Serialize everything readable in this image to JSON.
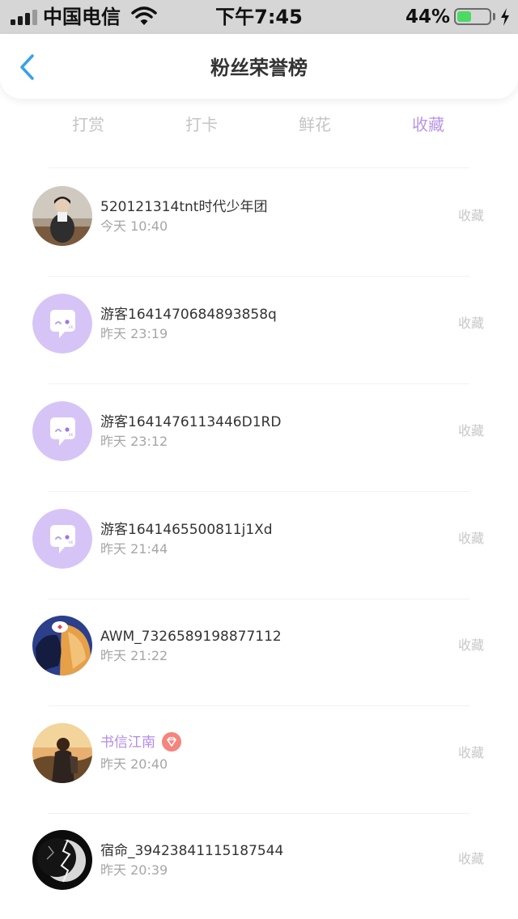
{
  "status_bar": {
    "carrier": "中国电信",
    "time": "下午7:45",
    "battery_percent": "44%",
    "battery_level": 0.44,
    "signal_bars": 3
  },
  "header": {
    "title": "粉丝荣誉榜",
    "back_icon": "chevron-left-icon"
  },
  "tabs": [
    {
      "label": "打赏",
      "active": false
    },
    {
      "label": "打卡",
      "active": false
    },
    {
      "label": "鲜花",
      "active": false
    },
    {
      "label": "收藏",
      "active": true
    }
  ],
  "colors": {
    "accent": "#b995e6",
    "back_arrow": "#3aa0e8",
    "battery": "#4cd964",
    "guest_avatar": "#d6c4f7"
  },
  "fans": [
    {
      "name": "520121314tnt时代少年团",
      "time": "今天 10:40",
      "action": "收藏",
      "avatar": "photo-person-avatar",
      "vip": false
    },
    {
      "name": "游客1641470684893858q",
      "time": "昨天 23:19",
      "action": "收藏",
      "avatar": "guest-chat-bubble-avatar",
      "vip": false
    },
    {
      "name": "游客1641476113446D1RD",
      "time": "昨天 23:12",
      "action": "收藏",
      "avatar": "guest-chat-bubble-avatar",
      "vip": false
    },
    {
      "name": "游客1641465500811j1Xd",
      "time": "昨天 21:44",
      "action": "收藏",
      "avatar": "guest-chat-bubble-avatar",
      "vip": false
    },
    {
      "name": "AWM_7326589198877112",
      "time": "昨天 21:22",
      "action": "收藏",
      "avatar": "photo-cartoon-avatar",
      "vip": false
    },
    {
      "name": "书信江南",
      "time": "昨天 20:40",
      "action": "收藏",
      "avatar": "photo-sunset-avatar",
      "vip": true,
      "vip_icon": "diamond-badge-icon"
    },
    {
      "name": "宿命_39423841115187544",
      "time": "昨天 20:39",
      "action": "收藏",
      "avatar": "photo-moon-avatar",
      "vip": false
    }
  ]
}
